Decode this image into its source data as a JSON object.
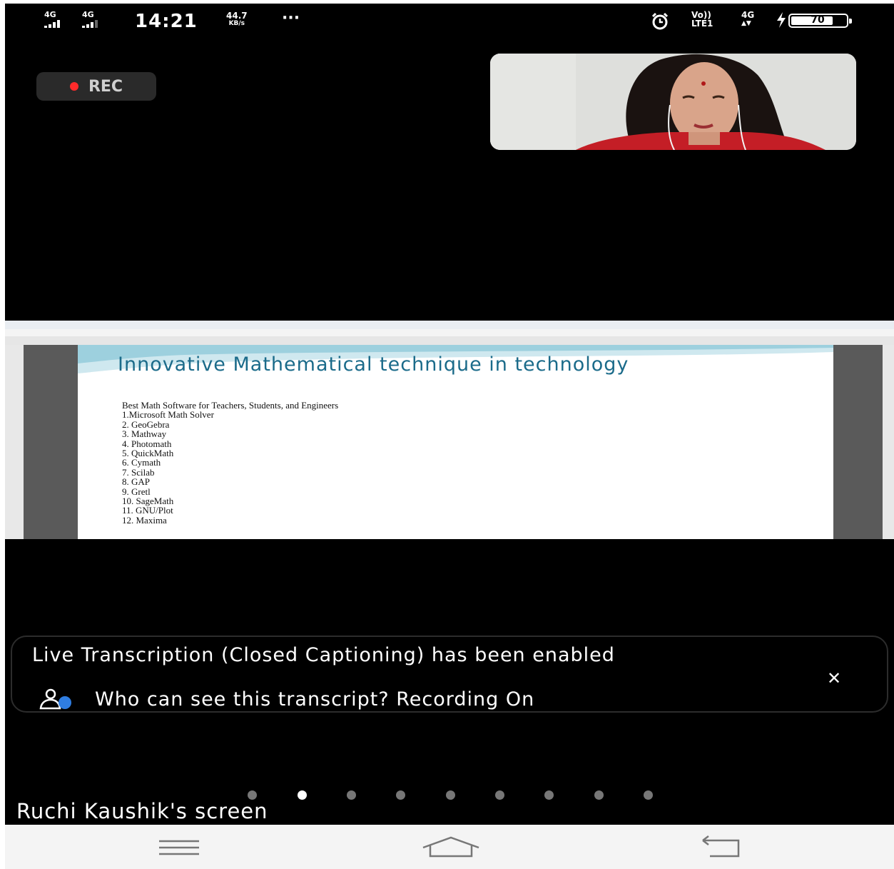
{
  "status_bar": {
    "sim1_label": "4G",
    "sim2_label": "4G",
    "time": "14:21",
    "speed_value": "44.7",
    "speed_unit": "KB/s",
    "overflow": "···",
    "volte_top": "Vo))",
    "volte_bottom": "LTE1",
    "net_label": "4G",
    "battery_percent": "70",
    "icons": [
      "signal-icon",
      "alarm-icon",
      "volte-icon",
      "charging-icon",
      "battery-icon"
    ]
  },
  "recording": {
    "label": "REC",
    "color": "#ff2b2b"
  },
  "video_tile": {
    "participant": "participant-video"
  },
  "shared_screen": {
    "slide_title": "Innovative Mathematical technique in technology",
    "subtitle": "Best Math Software for Teachers, Students, and Engineers",
    "items": [
      "1.Microsoft Math Solver",
      "2. GeoGebra",
      "3. Mathway",
      "4. Photomath",
      "5. QuickMath",
      "6. Cymath",
      "7. Scilab",
      "8. GAP",
      "9. Gretl",
      "10. SageMath",
      "11. GNU/Plot",
      "12. Maxima"
    ],
    "title_color": "#1b6b8a"
  },
  "transcription": {
    "message": "Live Transcription (Closed Captioning) has been enabled",
    "prompt": "Who can see this transcript? Recording On",
    "close_icon": "close-icon"
  },
  "pager": {
    "count": 9,
    "active_index": 1
  },
  "screen_owner": "Ruchi Kaushik's screen",
  "nav": {
    "icons": [
      "menu-icon",
      "home-icon",
      "back-icon"
    ]
  }
}
